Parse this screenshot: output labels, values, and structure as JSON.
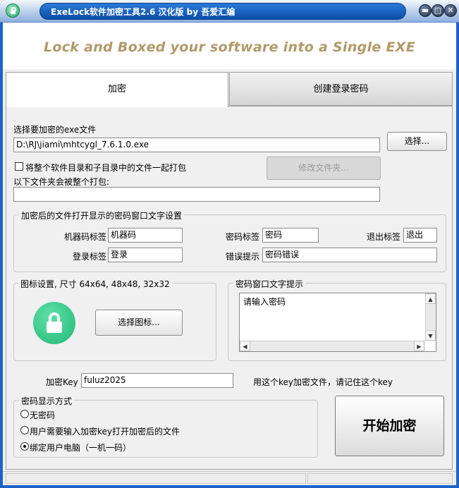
{
  "window": {
    "title": "ExeLock软件加密工具2.6 汉化版 by 吾爱汇编",
    "banner": "Lock and Boxed your software into a Single EXE",
    "controls": {
      "minimize": "▬",
      "maximize": "□",
      "close": "✕"
    }
  },
  "tabs": [
    {
      "label": "加密",
      "active": true
    },
    {
      "label": "创建登录密码",
      "active": false
    }
  ],
  "file": {
    "label": "选择要加密的exe文件",
    "path": "D:\\RJ\\jiami\\mhtcygl_7.6.1.0.exe",
    "browse_button": "选择...",
    "pack_checkbox_label": "将整个软件目录和子目录中的文件一起打包",
    "pack_checked": false,
    "modify_folder_button": "修改文件夹...",
    "folder_label": "以下文件夹会被整个打包:",
    "folder_value": ""
  },
  "password_window_settings": {
    "group_title": "加密后的文件打开显示的密码窗口文字设置",
    "fields": {
      "machine_code_label": "机器码标签",
      "machine_code_value": "机器码",
      "password_label": "密码标签",
      "password_value": "密码",
      "exit_label": "退出标签",
      "exit_value": "退出",
      "login_label": "登录标签",
      "login_value": "登录",
      "error_label": "错误提示",
      "error_value": "密码错误"
    }
  },
  "icon_settings": {
    "group_title": "图标设置, 尺寸 64x64, 48x48, 32x32",
    "icon": "lock-icon",
    "choose_button": "选择图标..."
  },
  "prompt_text": {
    "group_title": "密码窗口文字提示",
    "value": "请输入密码"
  },
  "key": {
    "label": "加密Key",
    "value": "fuluz2025",
    "hint": "用这个key加密文件，请记住这个key"
  },
  "password_mode": {
    "group_title": "密码显示方式",
    "options": [
      {
        "label": "无密码",
        "selected": false
      },
      {
        "label": "用户需要输入加密key打开加密后的文件",
        "selected": false
      },
      {
        "label": "绑定用户电脑（一机一码）",
        "selected": true
      }
    ]
  },
  "start_button": "开始加密",
  "colors": {
    "titlebar": "#1e64c8",
    "banner_text": "#b09a6a",
    "lock_green": "#22b877"
  }
}
